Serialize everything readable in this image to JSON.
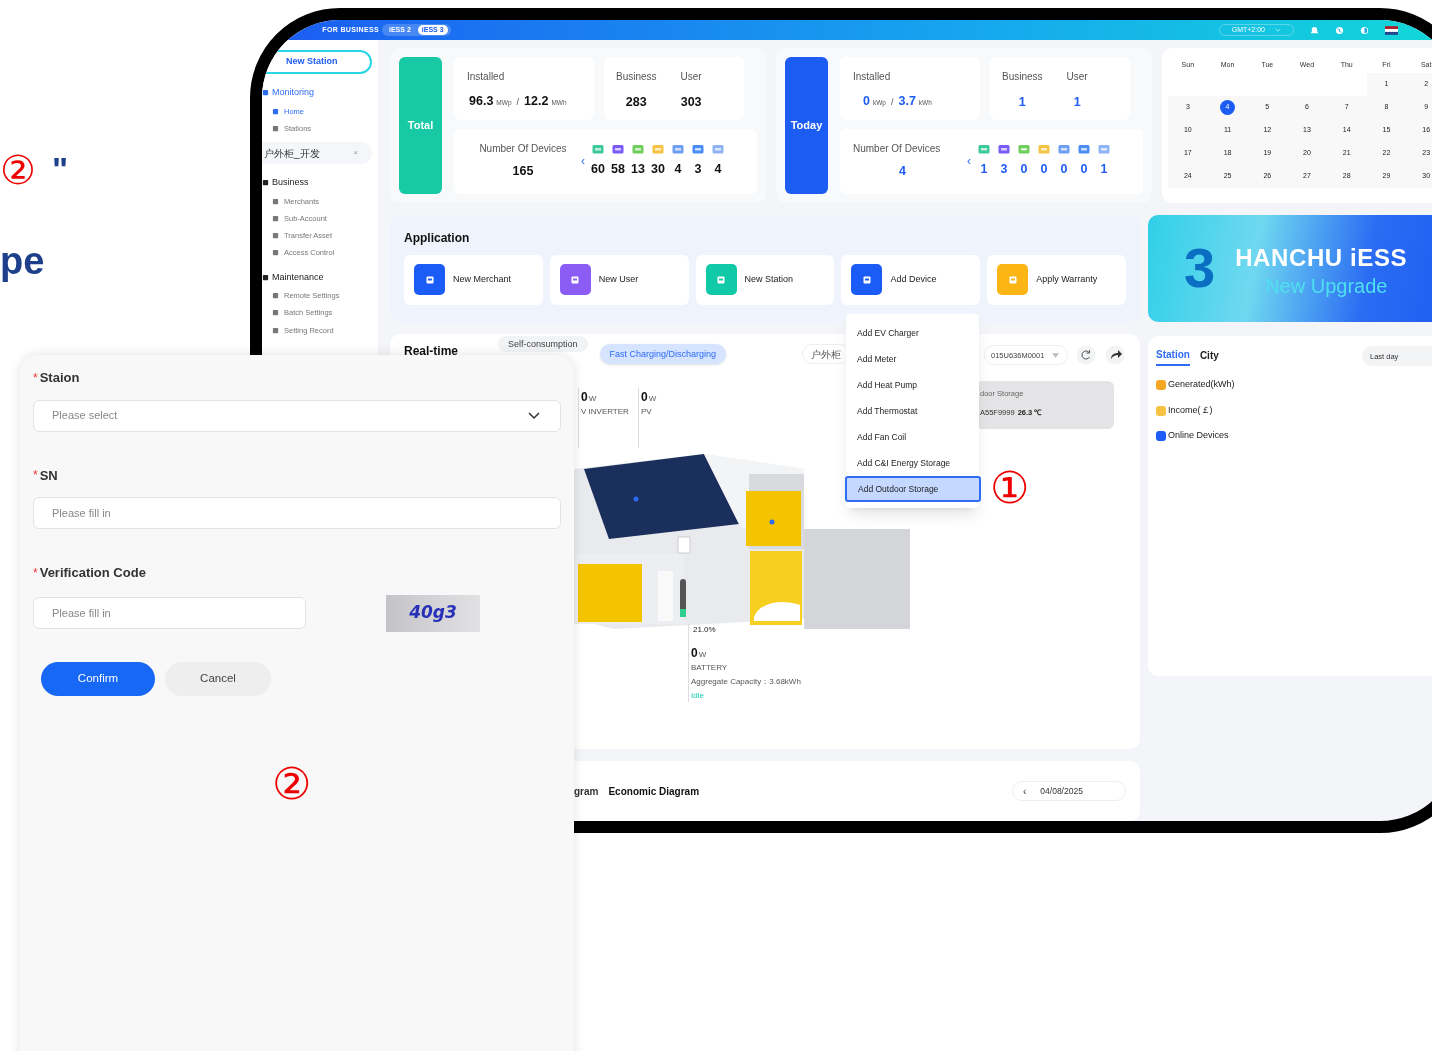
{
  "slide_text": {
    "marker": "②",
    "quote": "\"",
    "fragment": "pe"
  },
  "header": {
    "subtitle": "FOR BUSINESS",
    "versions": [
      {
        "label": "iESS 2",
        "selected": false
      },
      {
        "label": "iESS 3",
        "selected": true
      }
    ],
    "timezone": "GMT+2:00"
  },
  "sidebar": {
    "new_station": "New Station",
    "sections": [
      {
        "title": "Monitoring",
        "active": true,
        "items": [
          {
            "label": "Home",
            "selected": true
          },
          {
            "label": "Stations",
            "selected": false
          }
        ]
      },
      {
        "title": "Business",
        "active": false,
        "items": [
          {
            "label": "Merchants",
            "selected": false
          },
          {
            "label": "Sub-Account",
            "selected": false
          },
          {
            "label": "Transfer Asset",
            "selected": false
          },
          {
            "label": "Access Control",
            "selected": false
          }
        ]
      },
      {
        "title": "Maintenance",
        "active": false,
        "items": [
          {
            "label": "Remote Settings",
            "selected": false
          },
          {
            "label": "Batch Settings",
            "selected": false
          },
          {
            "label": "Setting Record",
            "selected": false
          }
        ]
      }
    ],
    "open_tab": {
      "label": "户外柜_开发",
      "close": "×"
    }
  },
  "summaries": [
    {
      "kind": "total",
      "label": "Total",
      "installed_label": "Installed",
      "power": "96.3",
      "power_unit": "MWp",
      "separator": "/",
      "energy": "12.2",
      "energy_unit": "MWh",
      "business_label": "Business",
      "business": "283",
      "user_label": "User",
      "user": "303",
      "devices_label": "Number Of Devices",
      "devices": "165",
      "prev": "‹",
      "device_counts": [
        "60",
        "58",
        "13",
        "30",
        "4",
        "3",
        "4"
      ]
    },
    {
      "kind": "today",
      "label": "Today",
      "installed_label": "Installed",
      "power": "0",
      "power_unit": "kWp",
      "separator": "/",
      "energy": "3.7",
      "energy_unit": "kWh",
      "business_label": "Business",
      "business": "1",
      "user_label": "User",
      "user": "1",
      "devices_label": "Number Of Devices",
      "devices": "4",
      "prev": "‹",
      "device_counts": [
        "1",
        "3",
        "0",
        "0",
        "0",
        "0",
        "1"
      ]
    }
  ],
  "calendar": {
    "weekdays": [
      "Sun",
      "Mon",
      "Tue",
      "Wed",
      "Thu",
      "Fri",
      "Sat"
    ],
    "weeks": [
      [
        {
          "d": "1",
          "selected": false
        },
        {
          "d": "2",
          "selected": false
        }
      ],
      [
        {
          "d": "3",
          "selected": false
        },
        {
          "d": "4",
          "selected": true
        },
        {
          "d": "5",
          "selected": false
        },
        {
          "d": "6",
          "selected": false
        },
        {
          "d": "7",
          "selected": false
        },
        {
          "d": "8",
          "selected": false
        },
        {
          "d": "9",
          "selected": false
        }
      ],
      [
        {
          "d": "10",
          "selected": false
        },
        {
          "d": "11",
          "selected": false
        },
        {
          "d": "12",
          "selected": false
        },
        {
          "d": "13",
          "selected": false
        },
        {
          "d": "14",
          "selected": false
        },
        {
          "d": "15",
          "selected": false
        },
        {
          "d": "16",
          "selected": false
        }
      ],
      [
        {
          "d": "17",
          "selected": false
        },
        {
          "d": "18",
          "selected": false
        },
        {
          "d": "19",
          "selected": false
        },
        {
          "d": "20",
          "selected": false
        },
        {
          "d": "21",
          "selected": false
        },
        {
          "d": "22",
          "selected": false
        },
        {
          "d": "23",
          "selected": false
        }
      ],
      [
        {
          "d": "24",
          "selected": false
        },
        {
          "d": "25",
          "selected": false
        },
        {
          "d": "26",
          "selected": false
        },
        {
          "d": "27",
          "selected": false
        },
        {
          "d": "28",
          "selected": false
        },
        {
          "d": "29",
          "selected": false
        },
        {
          "d": "30",
          "selected": false
        }
      ]
    ]
  },
  "application": {
    "title": "Application",
    "items": [
      {
        "label": "New Merchant",
        "color": "#1a5cf5"
      },
      {
        "label": "New User",
        "color": "#8b5cf6"
      },
      {
        "label": "New Station",
        "color": "#10c9a6"
      },
      {
        "label": "Add Device",
        "color": "#1a5cf5"
      },
      {
        "label": "Apply Warranty",
        "color": "#fbb615"
      }
    ]
  },
  "device_menu": {
    "items": [
      {
        "label": "Add EV Charger",
        "selected": false
      },
      {
        "label": "Add Meter",
        "selected": false
      },
      {
        "label": "Add Heat Pump",
        "selected": false
      },
      {
        "label": "Add Thermostat",
        "selected": false
      },
      {
        "label": "Add Fan Coil",
        "selected": false
      },
      {
        "label": "Add C&I Energy Storage",
        "selected": false
      },
      {
        "label": "Add Outdoor Storage",
        "selected": true
      }
    ],
    "annotation": "①"
  },
  "banner": {
    "number": "3",
    "brand": "HANCHU iESS",
    "tagline": "New Upgrade"
  },
  "realtime": {
    "title": "Real-time",
    "modes": [
      {
        "label": "Self-consumption",
        "selected": false
      },
      {
        "label": "Fast Charging/Discharging",
        "selected": true
      }
    ],
    "site": "户外柜",
    "device": "015U636M0001",
    "readings": [
      {
        "value": "0",
        "unit": "W",
        "label": "V INVERTER"
      },
      {
        "value": "0",
        "unit": "W",
        "label": "PV"
      }
    ],
    "storage": {
      "title": "door Storage",
      "serial": "A55F9999",
      "temperature": "26.3 ℃"
    },
    "battery": {
      "percent": "21.0%",
      "value": "0",
      "unit": "W",
      "label": "BATTERY",
      "capacity": "Aggregate Capacity：3.68kWh",
      "status": "Idle"
    }
  },
  "diagram": {
    "tabs": [
      {
        "label": "gram",
        "selected": false
      },
      {
        "label": "Economic Diagram",
        "selected": true
      }
    ],
    "prev": "‹",
    "date": "04/08/2025"
  },
  "ranking": {
    "tabs": [
      {
        "label": "Station",
        "selected": true
      },
      {
        "label": "City",
        "selected": false
      }
    ],
    "period": "Last day",
    "metrics": [
      {
        "label": "Generated(kWh)",
        "color": "#f5a623"
      },
      {
        "label": "Income(￡)",
        "color": "#f5c242"
      },
      {
        "label": "Online Devices",
        "color": "#1a5cf5"
      }
    ]
  },
  "form": {
    "required_mark": "*",
    "fields": [
      {
        "kind": "select",
        "label": "Staion",
        "required": true,
        "placeholder": "Please select"
      },
      {
        "kind": "text",
        "label": "SN",
        "required": true,
        "placeholder": "Please fill in"
      },
      {
        "kind": "captcha",
        "label": "Verification Code",
        "required": true,
        "placeholder": "Please fill in",
        "captcha": "40g3"
      }
    ],
    "buttons": [
      {
        "label": "Confirm",
        "kind": "primary"
      },
      {
        "label": "Cancel",
        "kind": "secondary"
      }
    ],
    "annotation": "②"
  }
}
